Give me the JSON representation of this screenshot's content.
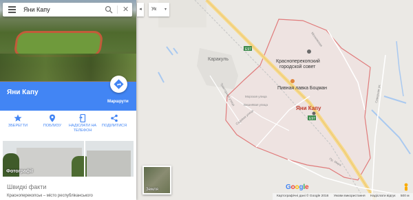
{
  "search": {
    "value": "Яни Капу"
  },
  "place": {
    "name": "Яни Капу",
    "directions_label": "Маршрути"
  },
  "actions": [
    {
      "label": "ЗБЕРЕГТИ",
      "icon": "star-icon"
    },
    {
      "label": "ПОБЛИЗУ",
      "icon": "nearby-icon"
    },
    {
      "label": "НАДІСЛАТИ НА ТЕЛЕФОН",
      "icon": "phone-icon"
    },
    {
      "label": "ПОДІЛИТИСЯ",
      "icon": "share-icon"
    }
  ],
  "photos_label": "Фотографії",
  "facts": {
    "heading": "Швидкі факти",
    "text": "Красноперекопськ – місто республіканського"
  },
  "map": {
    "language": "Ук",
    "labels": {
      "karakul": "Каракуль",
      "council": "Красноперекопский городской совет",
      "pub": "Пивная лавка Боцман",
      "city": "Яни Капу",
      "e97_a": "E97",
      "e97_b": "E97",
      "street_1": "Тракторная улица",
      "street_2": "Московская",
      "street_3": "Морская улица",
      "street_4": "Вишнёвая улица",
      "street_5": "Садовая улица",
      "street_6": "Пр. Мира",
      "street_7": "Северная ул."
    },
    "earth_label": "Земля",
    "footer": {
      "data": "Картографічні дані © Google 2016",
      "terms": "Умови використання",
      "feedback": "Надіслати відгук",
      "scale": "500 м"
    },
    "colors": {
      "boundary": "#e07b7b",
      "primary": "#4285f4",
      "road": "#f7d98b"
    }
  }
}
